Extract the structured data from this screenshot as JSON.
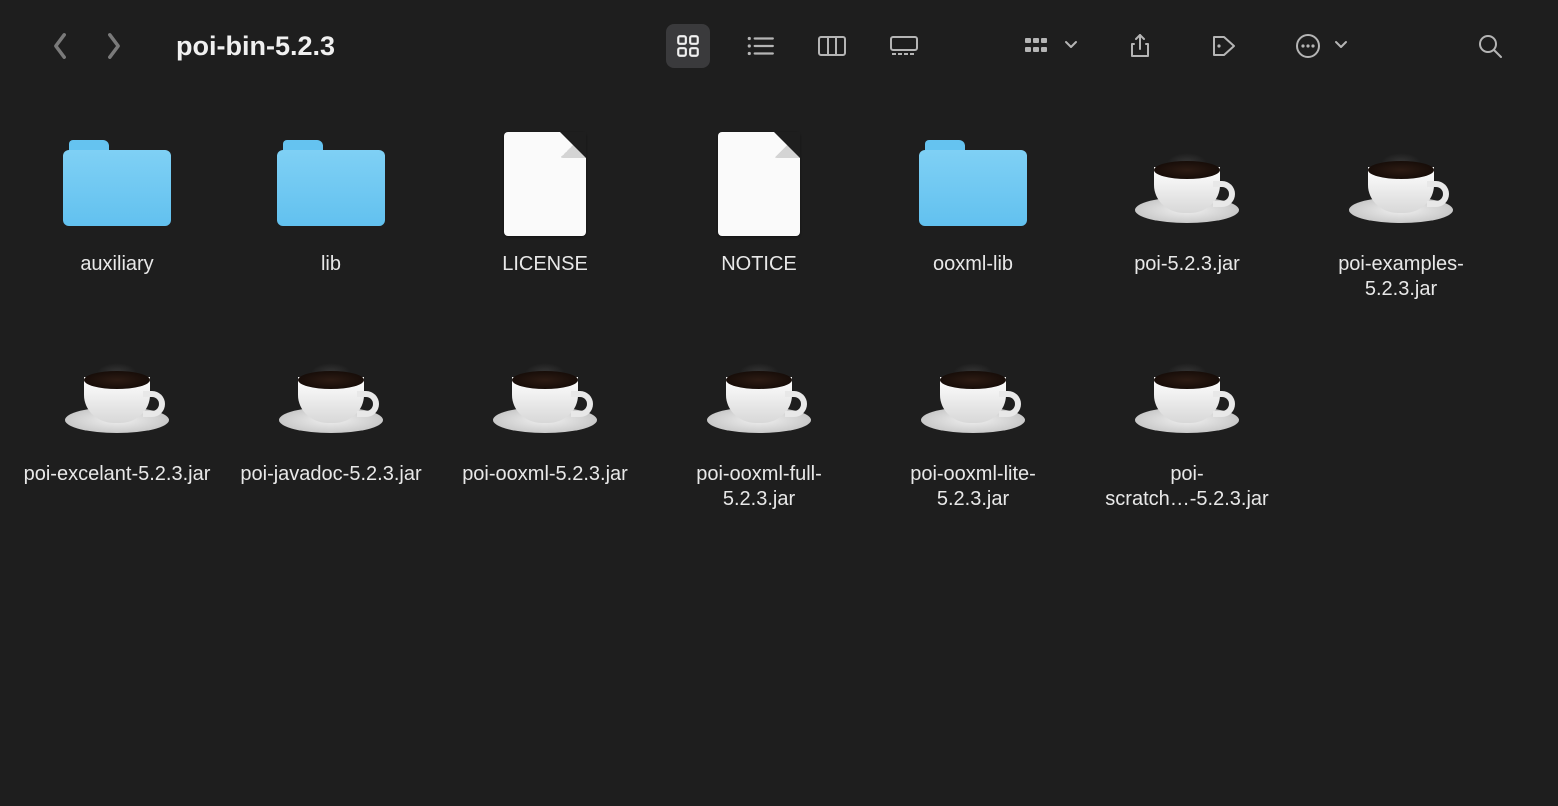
{
  "window": {
    "title": "poi-bin-5.2.3"
  },
  "items": [
    {
      "name": "auxiliary",
      "type": "folder"
    },
    {
      "name": "lib",
      "type": "folder"
    },
    {
      "name": "LICENSE",
      "type": "document"
    },
    {
      "name": "NOTICE",
      "type": "document"
    },
    {
      "name": "ooxml-lib",
      "type": "folder"
    },
    {
      "name": "poi-5.2.3.jar",
      "type": "jar"
    },
    {
      "name": "poi-examples-5.2.3.jar",
      "type": "jar"
    },
    {
      "name": "poi-excelant-5.2.3.jar",
      "type": "jar"
    },
    {
      "name": "poi-javadoc-5.2.3.jar",
      "type": "jar"
    },
    {
      "name": "poi-ooxml-5.2.3.jar",
      "type": "jar"
    },
    {
      "name": "poi-ooxml-full-5.2.3.jar",
      "type": "jar"
    },
    {
      "name": "poi-ooxml-lite-5.2.3.jar",
      "type": "jar"
    },
    {
      "name": "poi-scratch…-5.2.3.jar",
      "type": "jar"
    }
  ]
}
